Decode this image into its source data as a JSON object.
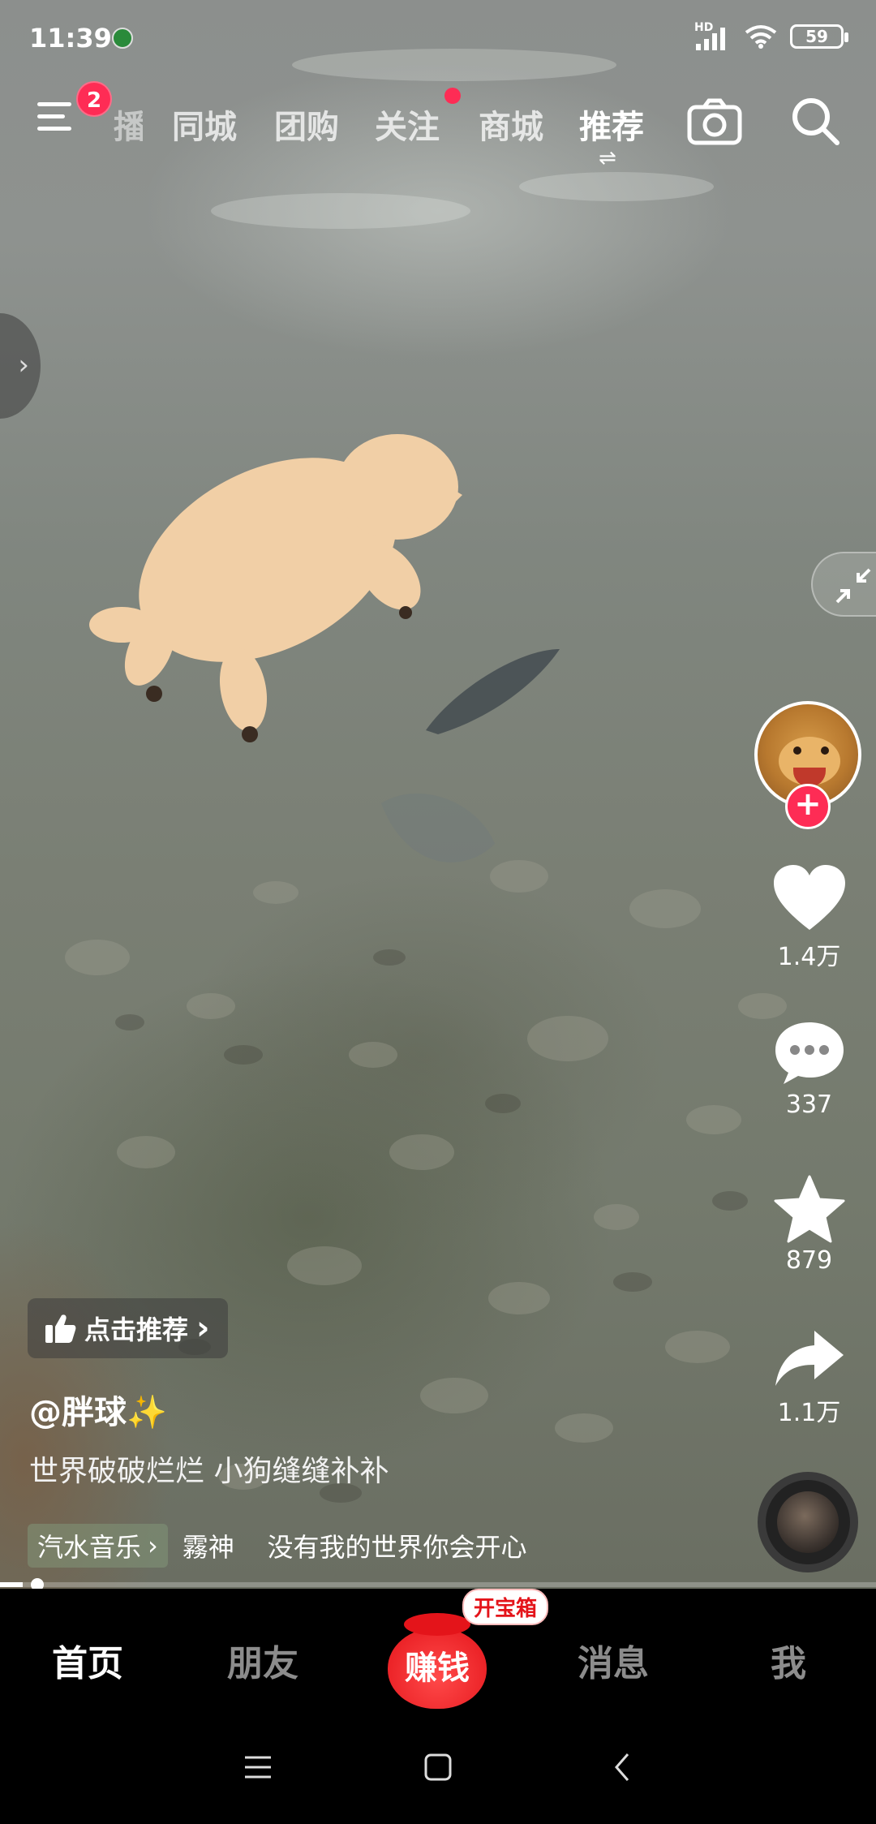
{
  "status_bar": {
    "time": "11:39",
    "network_label": "HD",
    "battery": "59"
  },
  "top_nav": {
    "menu_badge": "2",
    "tabs": [
      {
        "label": "播",
        "state": "partial"
      },
      {
        "label": "同城",
        "state": "normal"
      },
      {
        "label": "团购",
        "state": "normal"
      },
      {
        "label": "关注",
        "state": "normal",
        "has_dot": true
      },
      {
        "label": "商城",
        "state": "normal"
      },
      {
        "label": "推荐",
        "state": "active"
      }
    ],
    "swap_glyph": "⇌"
  },
  "actions": {
    "like_count": "1.4万",
    "comment_count": "337",
    "favorite_count": "879",
    "share_count": "1.1万"
  },
  "video_info": {
    "recommend_label": "点击推荐",
    "author": "@胖球",
    "author_sparkle": "✨",
    "caption": "世界破破烂烂 小狗缝缝补补",
    "music_tag": "汽水音乐",
    "music_text": "霧神    没有我的世界你会开心"
  },
  "progress": {
    "value": 0.026
  },
  "tab_bar": {
    "home": "首页",
    "friends": "朋友",
    "earn": "赚钱",
    "treasure_badge": "开宝箱",
    "messages": "消息",
    "me": "我"
  },
  "colors": {
    "accent": "#fe2c55",
    "earn_red": "#e4141a",
    "tabbar_bg": "#000000"
  },
  "icons": {
    "menu": "menu-icon",
    "camera": "camera-icon",
    "search": "search-icon",
    "like": "heart-icon",
    "comment": "comment-icon",
    "favorite": "star-icon",
    "share": "share-icon",
    "collapse": "collapse-icon"
  }
}
